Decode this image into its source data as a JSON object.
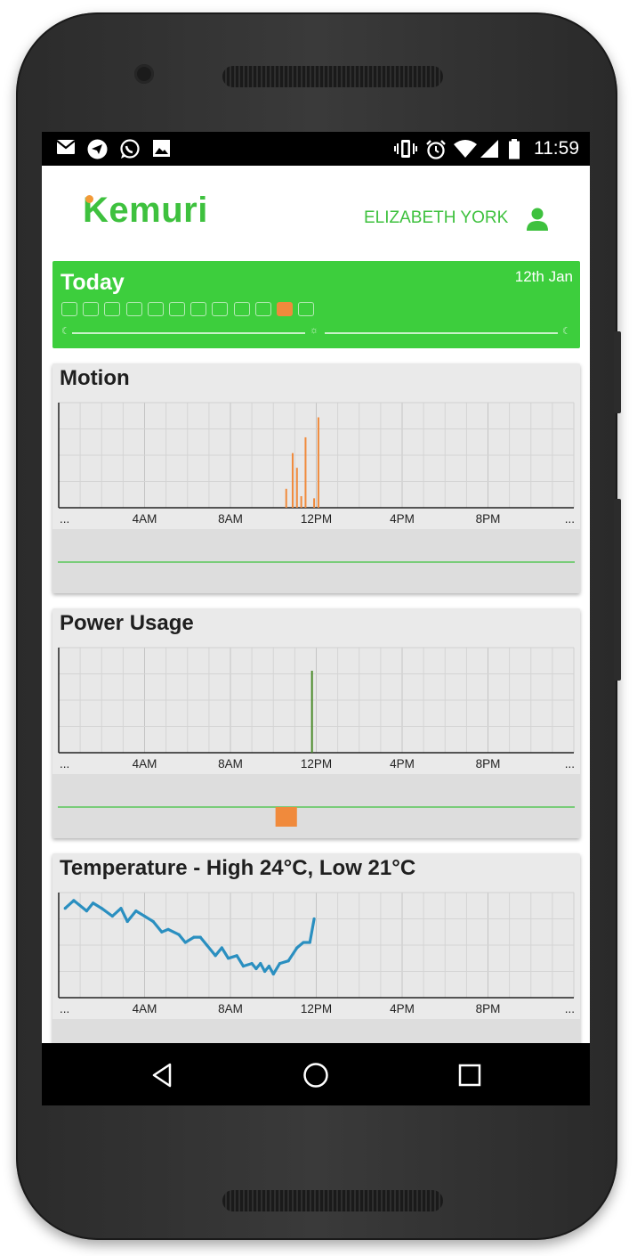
{
  "status_bar": {
    "time": "11:59",
    "left_icons": [
      "gmail-icon",
      "telegram-icon",
      "whatsapp-icon",
      "image-icon"
    ],
    "right_icons": [
      "vibrate-icon",
      "alarm-icon",
      "wifi-icon",
      "signal-icon",
      "battery-icon"
    ]
  },
  "header": {
    "logo_text": "Kemuri",
    "user_name": "ELIZABETH YORK",
    "user_icon": "user-icon"
  },
  "today": {
    "title": "Today",
    "date": "12th Jan",
    "hour_boxes": 12,
    "active_hour_box": 10
  },
  "colors": {
    "brand_green": "#3ec13e",
    "today_bg": "#3dce3d",
    "accent_orange": "#f08a3c",
    "temp_line": "#2a8fc0",
    "power_line": "#4a8a2a"
  },
  "x_tick_labels": [
    "...",
    "4AM",
    "8AM",
    "12PM",
    "4PM",
    "8PM",
    "..."
  ],
  "motion": {
    "title": "Motion",
    "chart_data": {
      "type": "bar",
      "x_unit": "hour",
      "xlim": [
        0,
        24
      ],
      "ylim": [
        0,
        1
      ],
      "x": [
        10.6,
        10.9,
        11.1,
        11.3,
        11.5,
        11.9,
        12.1
      ],
      "values": [
        0.18,
        0.52,
        0.38,
        0.11,
        0.67,
        0.09,
        0.86
      ],
      "grid": true
    },
    "activity_events": []
  },
  "power": {
    "title": "Power Usage",
    "chart_data": {
      "type": "bar",
      "x_unit": "hour",
      "xlim": [
        0,
        24
      ],
      "ylim": [
        0,
        1
      ],
      "x": [
        11.8
      ],
      "values": [
        0.78
      ],
      "grid": true
    },
    "activity_events": [
      {
        "start": 10.1,
        "end": 11.1
      }
    ]
  },
  "temperature": {
    "title": "Temperature - High 24°C, Low 21°C",
    "chart_data": {
      "type": "line",
      "x_unit": "hour",
      "xlim": [
        0,
        24
      ],
      "ylim": [
        20.5,
        24.5
      ],
      "x": [
        0.3,
        0.7,
        1.3,
        1.6,
        2.0,
        2.5,
        2.9,
        3.2,
        3.6,
        4.0,
        4.4,
        4.8,
        5.1,
        5.6,
        5.9,
        6.3,
        6.6,
        6.9,
        7.3,
        7.6,
        7.9,
        8.3,
        8.6,
        9.0,
        9.2,
        9.4,
        9.6,
        9.8,
        10.0,
        10.3,
        10.7,
        11.1,
        11.4,
        11.7,
        11.9
      ],
      "values": [
        23.9,
        24.2,
        23.8,
        24.1,
        23.9,
        23.6,
        23.9,
        23.4,
        23.8,
        23.6,
        23.4,
        23.0,
        23.1,
        22.9,
        22.6,
        22.8,
        22.8,
        22.5,
        22.1,
        22.4,
        22.0,
        22.1,
        21.7,
        21.8,
        21.6,
        21.8,
        21.5,
        21.7,
        21.4,
        21.8,
        21.9,
        22.4,
        22.6,
        22.6,
        23.5
      ],
      "grid": true
    }
  }
}
